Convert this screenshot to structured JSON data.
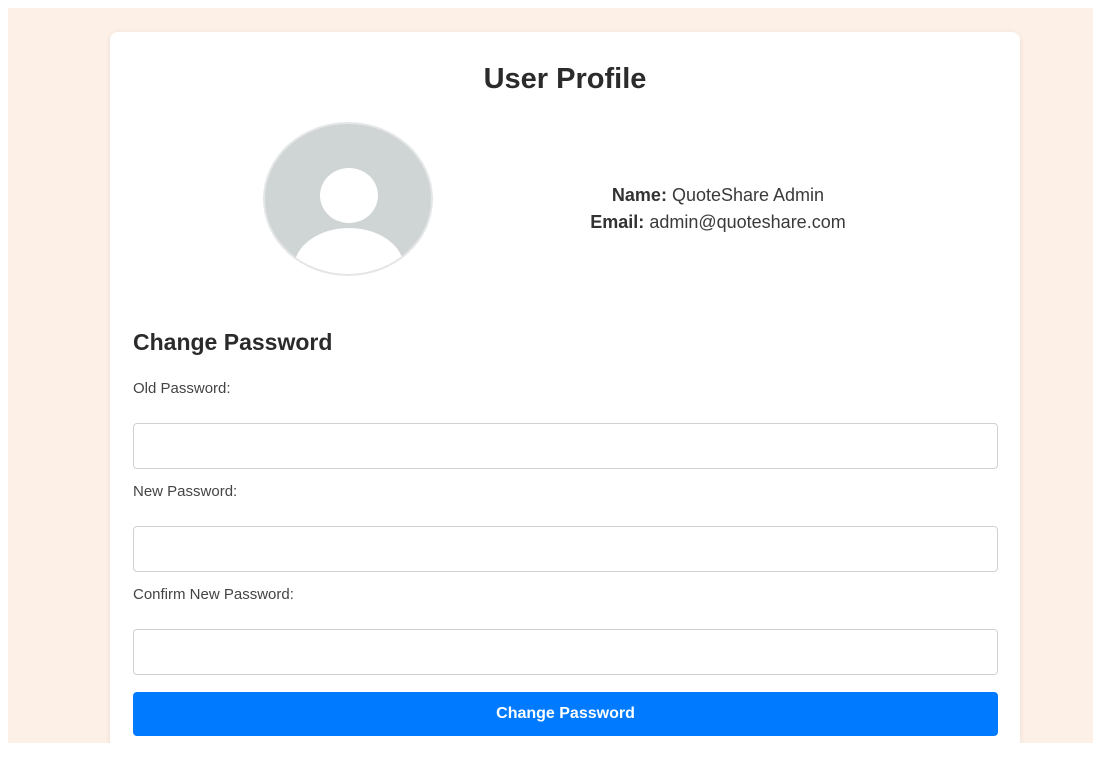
{
  "profile": {
    "title": "User Profile",
    "name_label": "Name:",
    "name_value": "QuoteShare Admin",
    "email_label": "Email:",
    "email_value": "admin@quoteshare.com"
  },
  "password_form": {
    "title": "Change Password",
    "old_password_label": "Old Password:",
    "new_password_label": "New Password:",
    "confirm_password_label": "Confirm New Password:",
    "old_password_value": "",
    "new_password_value": "",
    "confirm_password_value": "",
    "submit_label": "Change Password"
  },
  "colors": {
    "page_background": "#fdf0e6",
    "card_background": "#ffffff",
    "primary_button": "#007bff",
    "avatar_fill": "#cfd4d5"
  },
  "icons": {
    "avatar": "default-user-avatar-icon"
  }
}
